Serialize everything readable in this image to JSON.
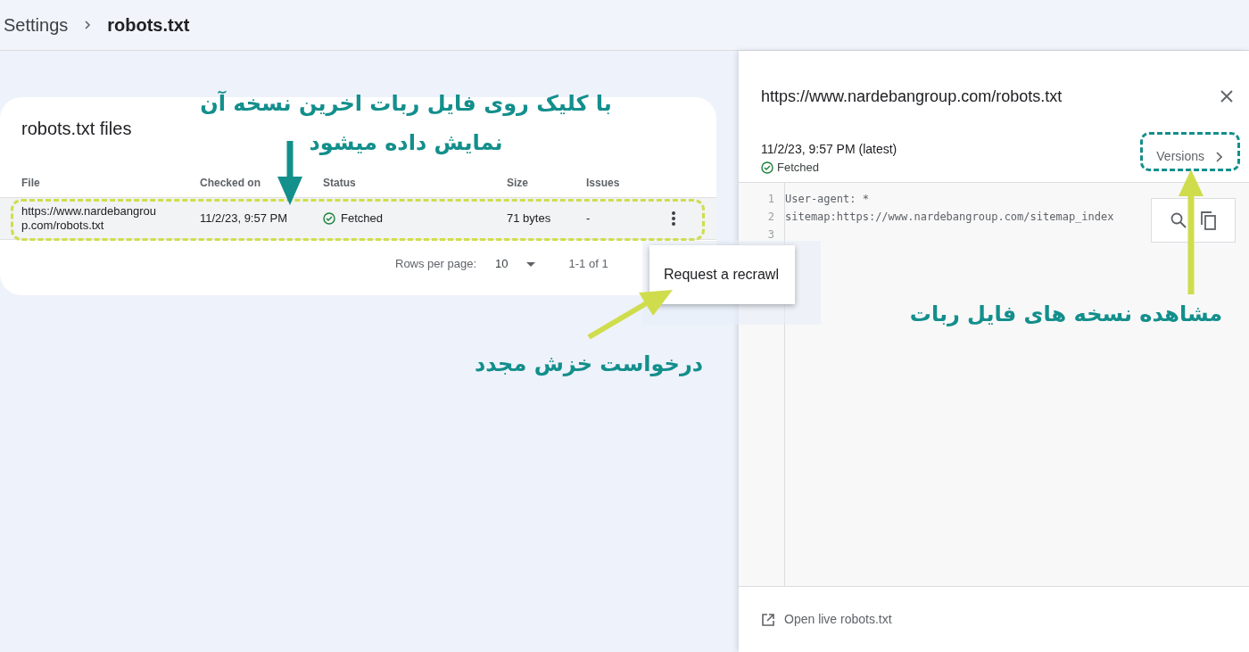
{
  "breadcrumb": [
    {
      "label": "Settings"
    },
    {
      "label": "robots.txt"
    }
  ],
  "card": {
    "title": "robots.txt files",
    "columns": [
      "File",
      "Checked on",
      "Status",
      "Size",
      "Issues"
    ],
    "rows": [
      {
        "file": "https://www.nardebangroup.com/robots.txt",
        "checked_on": "11/2/23, 9:57 PM",
        "status": "Fetched",
        "size": "71 bytes",
        "issues": "-"
      }
    ],
    "pagination": {
      "label": "Rows per page:",
      "value": "10",
      "range": "1-1 of 1"
    }
  },
  "context_menu": {
    "items": [
      "Request a recrawl"
    ]
  },
  "panel": {
    "title": "https://www.nardebangroup.com/robots.txt",
    "version_date": "11/2/23, 9:57 PM (latest)",
    "status": "Fetched",
    "versions_button": "Versions",
    "code_lines": [
      {
        "number": "1",
        "text": "User-agent: *"
      },
      {
        "number": "2",
        "text": "sitemap:https://www.nardebangroup.com/sitemap_index"
      },
      {
        "number": "3"
      }
    ],
    "footer_link": "Open live robots.txt"
  },
  "annotations": [
    {
      "lines": [
        "با کلیک روی فایل ربات اخرین نسخه آن",
        "نمایش داده میشود"
      ]
    },
    {
      "lines": [
        "درخواست خزش مجدد"
      ]
    },
    {
      "lines": [
        "مشاهده نسخه های فایل ربات"
      ]
    }
  ]
}
